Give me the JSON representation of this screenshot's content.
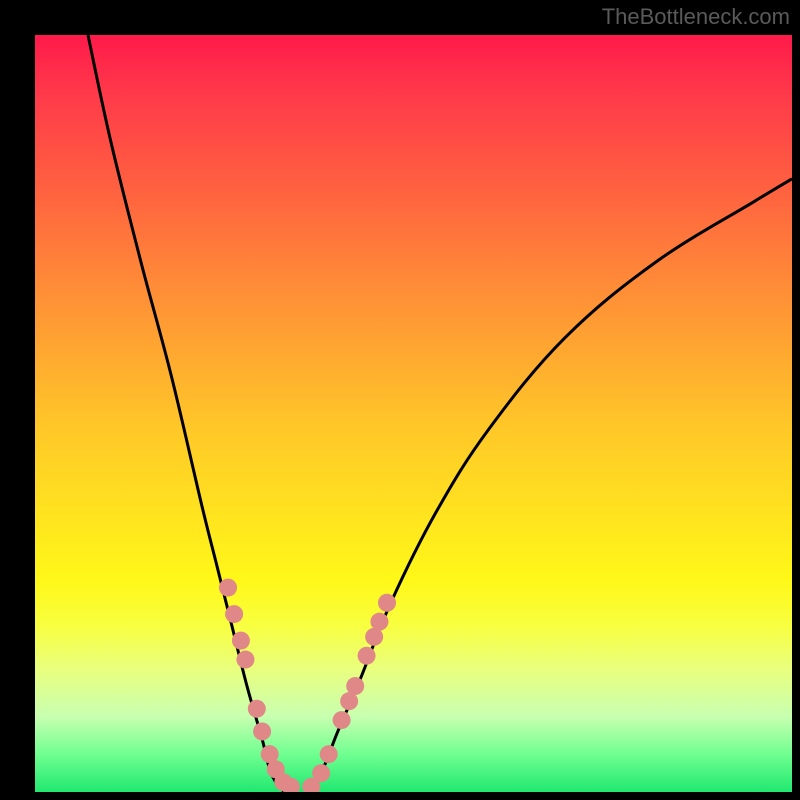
{
  "watermark": "TheBottleneck.com",
  "chart_data": {
    "type": "line",
    "title": "",
    "xlabel": "",
    "ylabel": "",
    "xlim": [
      0,
      100
    ],
    "ylim": [
      0,
      100
    ],
    "series": [
      {
        "name": "left-curve",
        "x": [
          7,
          10,
          14,
          18,
          22,
          24,
          26,
          28,
          30,
          31,
          32,
          33
        ],
        "y": [
          100,
          86,
          70,
          55,
          38,
          30,
          22,
          14,
          7,
          3,
          1,
          0
        ]
      },
      {
        "name": "right-curve",
        "x": [
          36,
          38,
          40,
          43,
          47,
          53,
          60,
          70,
          82,
          95,
          100
        ],
        "y": [
          0,
          3,
          8,
          15,
          25,
          37,
          48,
          60,
          70,
          78,
          81
        ]
      },
      {
        "name": "left-dots",
        "x": [
          25.5,
          26.3,
          27.2,
          27.8,
          29.3,
          30.0,
          31.0,
          31.8,
          32.8,
          33.8
        ],
        "y": [
          27.0,
          23.5,
          20.0,
          17.5,
          11.0,
          8.0,
          5.0,
          3.0,
          1.3,
          0.7
        ]
      },
      {
        "name": "right-dots",
        "x": [
          36.5,
          37.8,
          38.8,
          40.5,
          41.5,
          42.3,
          43.8,
          44.8,
          45.5,
          46.5
        ],
        "y": [
          0.7,
          2.5,
          5.0,
          9.5,
          12.0,
          14.0,
          18.0,
          20.5,
          22.5,
          25.0
        ]
      }
    ],
    "gradient_colors": {
      "top": "#ff1a4a",
      "mid": "#ffe020",
      "bottom": "#20e870"
    },
    "curve_color": "#000000",
    "dot_color": "#e08888"
  }
}
